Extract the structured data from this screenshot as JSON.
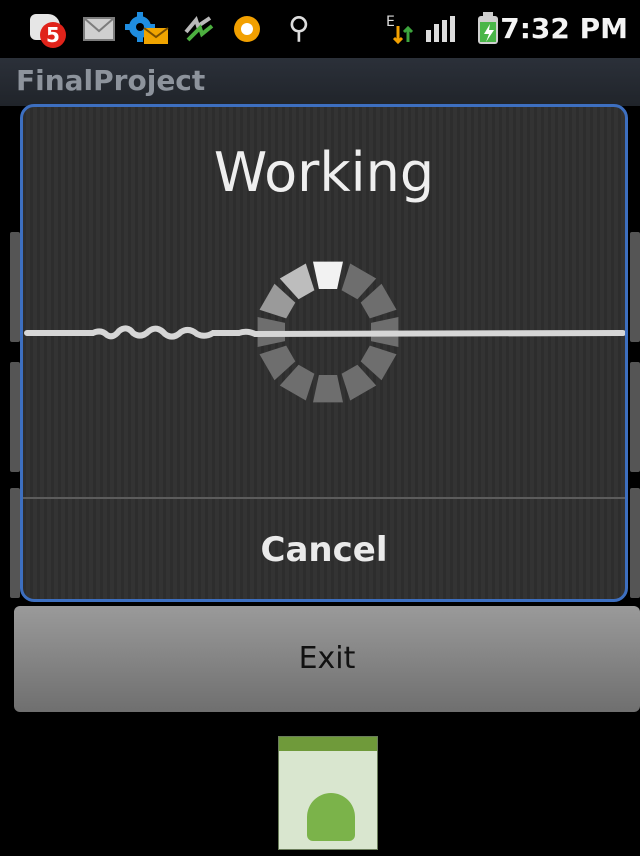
{
  "status_bar": {
    "notification_count": "5",
    "time": "7:32 PM",
    "icons": [
      "notification-badge-icon",
      "mail-icon",
      "settings-mail-icon",
      "sync-icon",
      "timer-icon",
      "usb-icon",
      "edge-data-icon",
      "signal-icon",
      "battery-icon"
    ]
  },
  "app": {
    "title": "FinalProject"
  },
  "dialog": {
    "title": "Working",
    "cancel_label": "Cancel"
  },
  "main": {
    "exit_label": "Exit"
  },
  "colors": {
    "dialog_border": "#3d6fc0",
    "badge": "#e0231a",
    "timer": "#f2a000"
  }
}
